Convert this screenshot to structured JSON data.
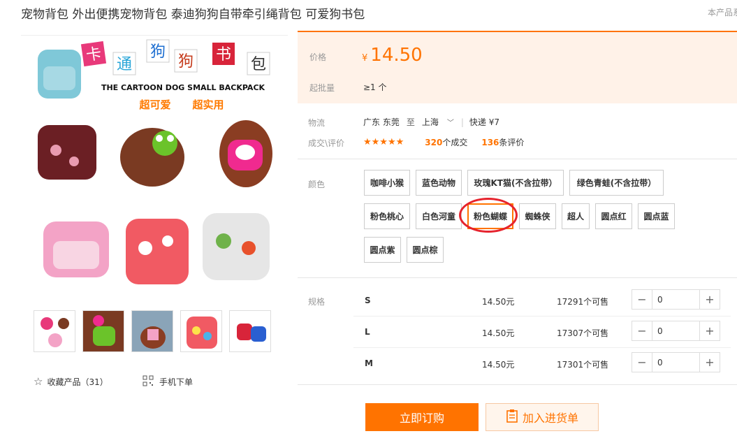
{
  "product": {
    "title": "宠物背包 外出便携宠物背包 泰迪狗狗自带牵引绳背包 可爱狗书包",
    "notice": "本产品系"
  },
  "gallery": {
    "main_image_label": "卡通狗狗书包 THE CARTOON DOG SMALL BACKPACK 超可爱 超实用",
    "thumbs": [
      "thumb-1",
      "thumb-2",
      "thumb-3",
      "thumb-4",
      "thumb-5"
    ]
  },
  "actions_left": {
    "favorite": "收藏产品（31）",
    "mobile": "手机下单"
  },
  "price": {
    "label": "价格",
    "currency": "¥",
    "value": "14.50",
    "moq_label": "起批量",
    "moq_value": "≥1 个"
  },
  "logistics": {
    "label": "物流",
    "from": "广东 东莞",
    "to_word": "至",
    "to": "上海",
    "shipping": "快递 ¥7"
  },
  "reviews": {
    "label": "成交\\评价",
    "stars": "★★★★★",
    "deals_num": "320",
    "deals_text": "个成交",
    "reviews_num": "136",
    "reviews_text": "条评价"
  },
  "colors": {
    "label": "颜色",
    "options": [
      "咖啡小猴",
      "蓝色动物",
      "玫瑰KT猫(不含拉带）",
      "绿色青蛙(不含拉带）",
      "粉色桃心",
      "白色河童",
      "粉色蝴蝶",
      "蜘蛛侠",
      "超人",
      "圆点红",
      "圆点蓝",
      "圆点紫",
      "圆点棕"
    ],
    "selected": "粉色蝴蝶"
  },
  "specs": {
    "label": "规格",
    "rows": [
      {
        "size": "S",
        "price": "14.50元",
        "stock": "17291个可售",
        "qty": "0"
      },
      {
        "size": "L",
        "price": "14.50元",
        "stock": "17307个可售",
        "qty": "0"
      },
      {
        "size": "M",
        "price": "14.50元",
        "stock": "17301个可售",
        "qty": "0"
      }
    ]
  },
  "buttons": {
    "buy": "立即订购",
    "cart": "加入进货单"
  },
  "colors_theme": {
    "accent": "#ff7300",
    "price_bg": "#fff2e8",
    "highlight": "#e6232d"
  }
}
